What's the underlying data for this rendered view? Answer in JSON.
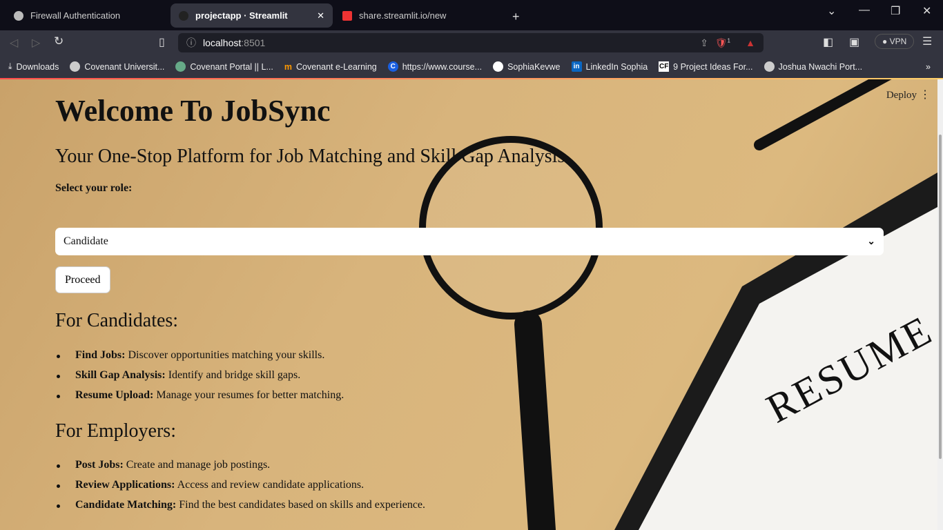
{
  "browser": {
    "tabs": [
      {
        "title": "Firewall Authentication",
        "icon": "globe-icon",
        "active": false
      },
      {
        "title": "projectapp · Streamlit",
        "icon": "streamlit-icon",
        "active": true
      },
      {
        "title": "share.streamlit.io/new",
        "icon": "streamlit-icon",
        "active": false
      }
    ],
    "url_host": "localhost",
    "url_port": ":8501",
    "vpn_label": "VPN",
    "shields_count": "1",
    "bookmarks": [
      {
        "label": "Downloads",
        "icon": "download-icon"
      },
      {
        "label": "Covenant Universit...",
        "icon": "globe-icon"
      },
      {
        "label": "Covenant Portal || L...",
        "icon": "portal-icon"
      },
      {
        "label": "Covenant e-Learning",
        "icon": "moodle-icon"
      },
      {
        "label": "https://www.course...",
        "icon": "coursera-icon"
      },
      {
        "label": "SophiaKevwe",
        "icon": "github-icon"
      },
      {
        "label": "LinkedIn Sophia",
        "icon": "linkedin-icon"
      },
      {
        "label": "9 Project Ideas For...",
        "icon": "cf-icon"
      },
      {
        "label": "Joshua Nwachi Port...",
        "icon": "globe-icon"
      }
    ]
  },
  "app": {
    "deploy_label": "Deploy",
    "title": "Welcome To JobSync",
    "subtitle": "Your One-Stop Platform for Job Matching and Skill Gap Analysis",
    "role_label": "Select your role:",
    "role_value": "Candidate",
    "proceed_label": "Proceed",
    "background_text": "RESUME",
    "candidates": {
      "heading": "For Candidates:",
      "items": [
        {
          "bold": "Find Jobs:",
          "text": " Discover opportunities matching your skills."
        },
        {
          "bold": "Skill Gap Analysis:",
          "text": " Identify and bridge skill gaps."
        },
        {
          "bold": "Resume Upload:",
          "text": " Manage your resumes for better matching."
        }
      ]
    },
    "employers": {
      "heading": "For Employers:",
      "items": [
        {
          "bold": "Post Jobs:",
          "text": " Create and manage job postings."
        },
        {
          "bold": "Review Applications:",
          "text": " Access and review candidate applications."
        },
        {
          "bold": "Candidate Matching:",
          "text": " Find the best candidates based on skills and experience."
        }
      ]
    }
  }
}
